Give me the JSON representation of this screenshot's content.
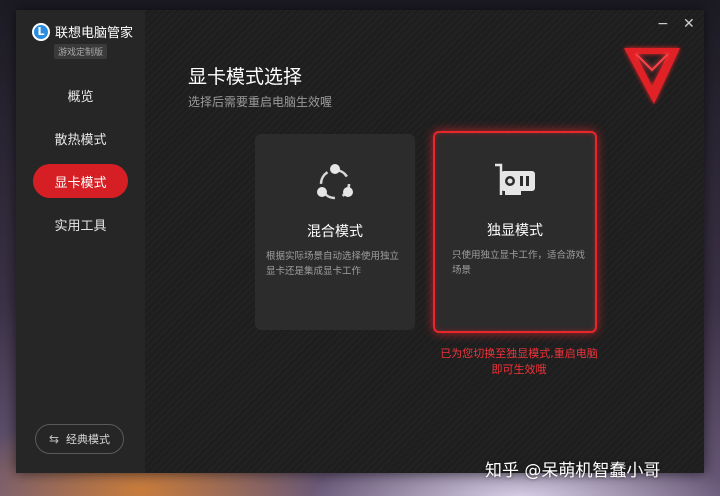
{
  "app": {
    "title": "联想电脑管家",
    "edition": "游戏定制版",
    "logo_letter": "L"
  },
  "window_controls": {
    "minimize": "−",
    "close": "✕"
  },
  "sidebar": {
    "items": [
      {
        "label": "概览",
        "active": false
      },
      {
        "label": "散热模式",
        "active": false
      },
      {
        "label": "显卡模式",
        "active": true
      },
      {
        "label": "实用工具",
        "active": false
      }
    ],
    "classic_button": {
      "label": "经典模式",
      "icon": "swap-icon"
    }
  },
  "main": {
    "title": "显卡模式选择",
    "subtitle": "选择后需要重启电脑生效喔",
    "cards": [
      {
        "icon": "share-nodes-icon",
        "title": "混合模式",
        "description": "根据实际场景自动选择使用独立显卡还是集成显卡工作",
        "selected": false
      },
      {
        "icon": "graphics-card-icon",
        "title": "独显模式",
        "description": "只使用独立显卡工作，适合游戏场景",
        "selected": true
      }
    ],
    "notice": "已为您切换至独显模式,重启电脑即可生效哦"
  },
  "watermark": "知乎 @呆萌机智蠢小哥",
  "colors": {
    "accent": "#d61f25",
    "notice": "#f0333a",
    "sidebar_bg": "#262626",
    "main_bg": "#1e1e1e",
    "card_bg": "#2c2c2c"
  }
}
